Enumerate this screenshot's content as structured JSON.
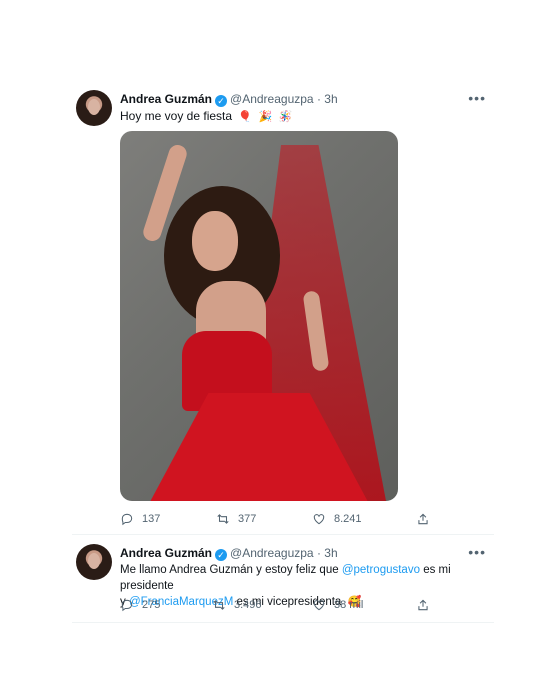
{
  "tweets": [
    {
      "author_name": "Andrea Guzmán",
      "handle": "@Andreaguzpa",
      "dot": "·",
      "time": "3h",
      "text": "Hoy me voy de fiesta",
      "emojis": [
        "🎈",
        "🎉",
        "🪅"
      ],
      "actions": {
        "replies": "137",
        "retweets": "377",
        "likes": "8.241"
      }
    },
    {
      "author_name": "Andrea Guzmán",
      "handle": "@Andreaguzpa",
      "dot": "·",
      "time": "3h",
      "text_part1": "Me llamo Andrea Guzmán y estoy feliz que",
      "mention1": "@petrogustavo",
      "text_part2": "es mi presidente",
      "text_part3": "y",
      "mention2": "@FranciaMarquezM",
      "text_part4": "es mi vicepresidenta",
      "emoji": "🥰",
      "actions": {
        "replies": "275",
        "retweets": "3.496",
        "likes": "38 mil"
      }
    }
  ],
  "more_icon": "•••",
  "verified_icon": "✓",
  "colors": {
    "accent": "#1d9bf0",
    "muted": "#536471",
    "text": "#0f1419",
    "divider": "#eff3f4"
  }
}
